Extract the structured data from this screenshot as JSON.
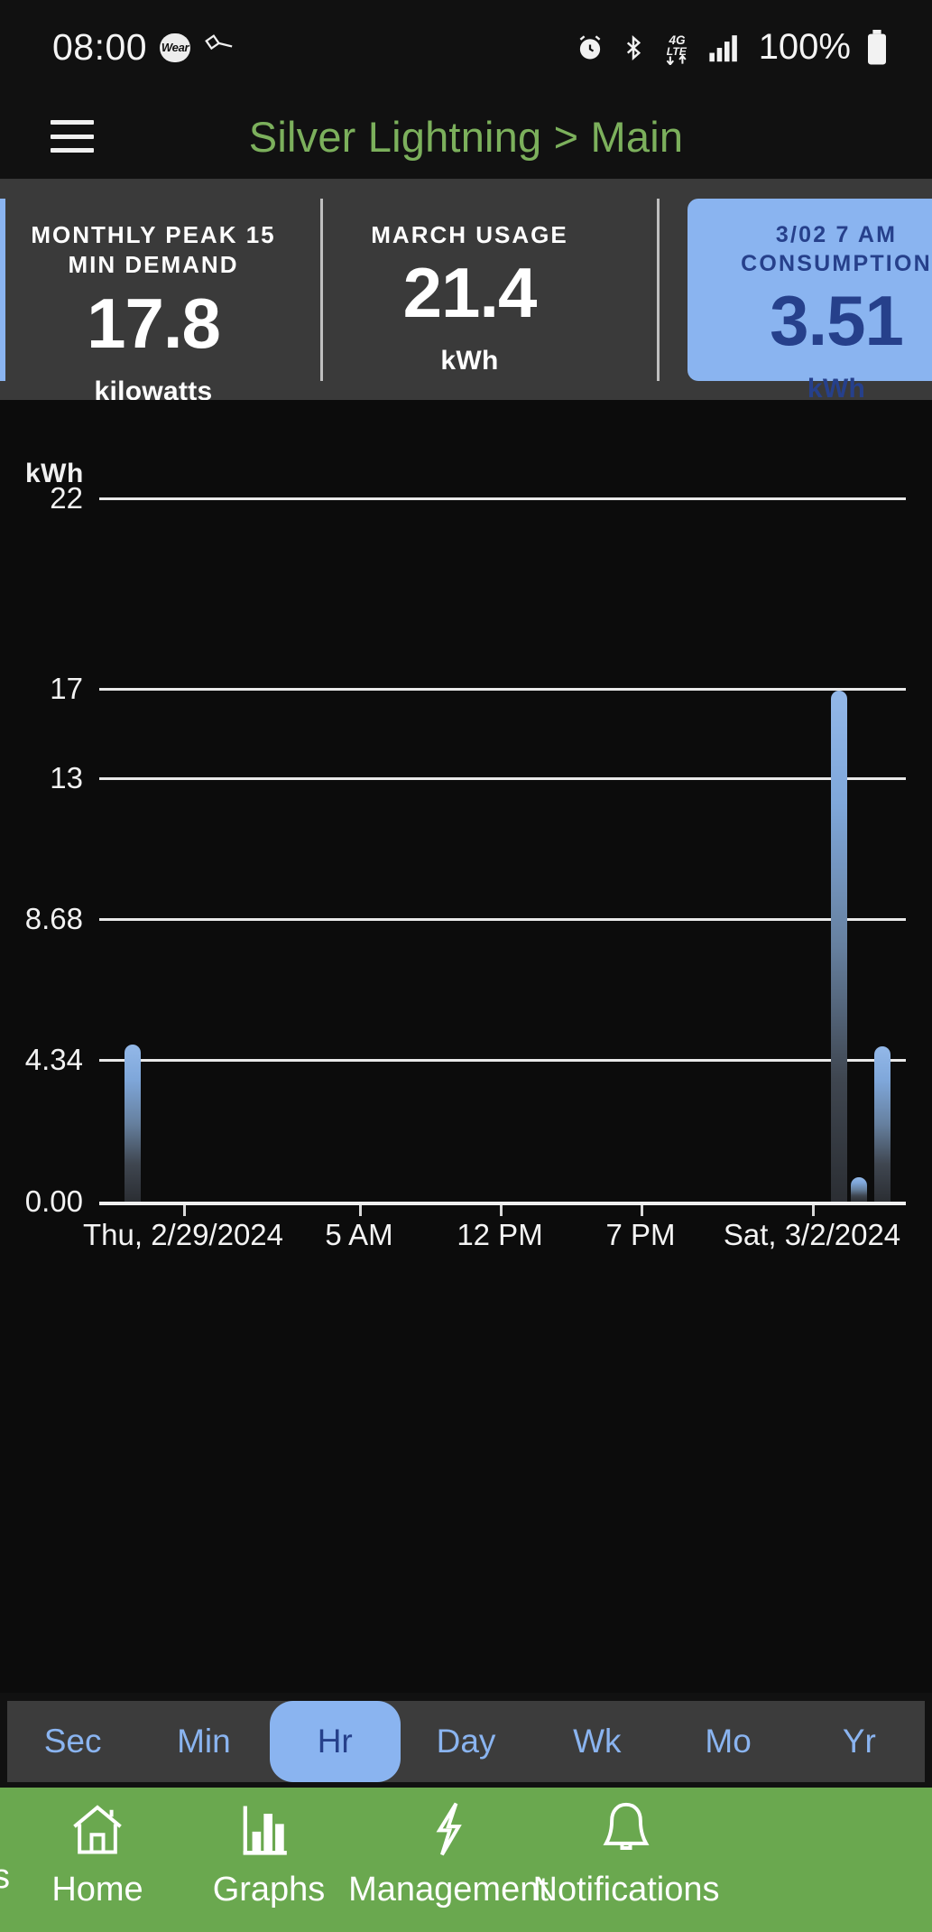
{
  "status_bar": {
    "time": "08:00",
    "wear_badge": "Wear",
    "battery_percent": "100%",
    "icons": [
      "wear-badge-icon",
      "flashlight-icon",
      "alarm-icon",
      "bluetooth-icon",
      "4g-lte-data-icon",
      "signal-bars-icon",
      "battery-icon"
    ]
  },
  "header": {
    "menu_icon": "hamburger-menu-icon",
    "title": "Silver Lightning > Main",
    "title_color": "#7cb05c"
  },
  "cards": [
    {
      "title": "MONTHLY PEAK 15 MIN DEMAND",
      "value": "17.8",
      "unit": "kilowatts",
      "accent": "#8ab4f0",
      "highlighted": false
    },
    {
      "title": "MARCH USAGE",
      "value": "21.4",
      "unit": "kWh",
      "highlighted": false
    },
    {
      "title": "3/02 7 AM CONSUMPTION",
      "value": "3.51",
      "unit": "kWh",
      "highlighted": true,
      "bg": "#8ab4f0",
      "fg": "#26408b"
    }
  ],
  "chart_data": {
    "type": "bar",
    "title": "",
    "ylabel": "kWh",
    "xlabel": "",
    "ylim": [
      0,
      22
    ],
    "ytick_labels": [
      "22",
      "17",
      "13",
      "8.68",
      "4.34",
      "0.00"
    ],
    "ytick_values": [
      22,
      17,
      13,
      8.68,
      4.34,
      0.0
    ],
    "xtick_labels": [
      "Thu, 2/29/2024",
      "5 AM",
      "12 PM",
      "7 PM",
      "Sat, 3/2/2024"
    ],
    "grid": true,
    "legend": "none",
    "bar_color_top": "#93b8e8",
    "bar_color_bottom": "#2b2e33",
    "x": [
      2.0,
      44.0,
      45.2,
      46.6
    ],
    "values": [
      4.8,
      16.9,
      0.75,
      4.75
    ],
    "x_min": 0,
    "x_max": 48
  },
  "range_selector": {
    "options": [
      "Sec",
      "Min",
      "Hr",
      "Day",
      "Wk",
      "Mo",
      "Yr"
    ],
    "selected": "Hr",
    "active_bg": "#8ab4f0",
    "text_color": "#8ab4f0"
  },
  "bottom_nav": {
    "background": "#6aa84f",
    "items": [
      {
        "label": "Home",
        "icon": "home-icon"
      },
      {
        "label": "Graphs",
        "icon": "bar-chart-icon"
      },
      {
        "label": "Management",
        "icon": "lightning-bolt-icon"
      },
      {
        "label": "Notifications",
        "icon": "bell-icon"
      }
    ]
  }
}
